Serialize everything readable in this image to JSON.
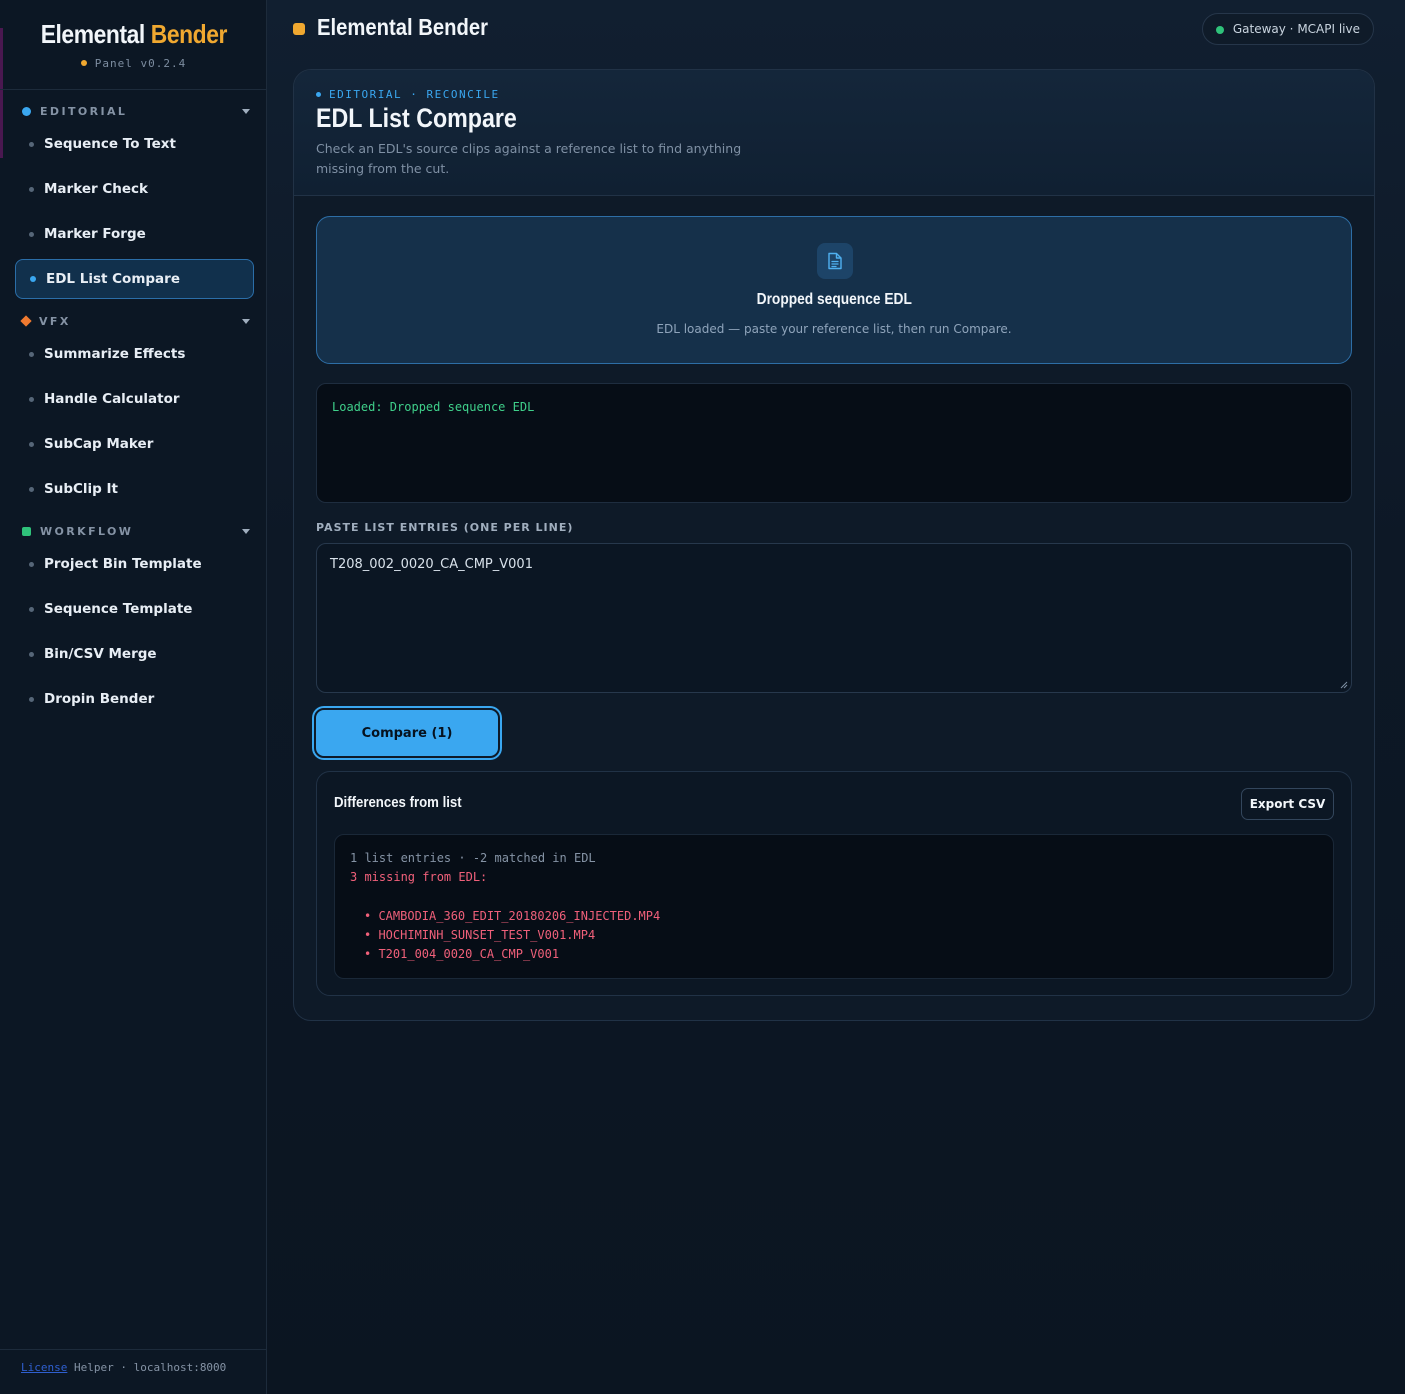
{
  "app": {
    "name_prefix": "Elemental",
    "name_highlight": "Bender",
    "version": "Panel v0.2.4"
  },
  "colors": {
    "accent_blue": "#3aa7f0",
    "accent_orange": "#f0a830",
    "status_green": "#2fc27a",
    "error_red": "#f0607a"
  },
  "sidebar": {
    "sections": [
      {
        "label": "EDITORIAL",
        "icon": "circle-icon",
        "items": [
          {
            "label": "Sequence To Text",
            "active": false
          },
          {
            "label": "Marker Check",
            "active": false
          },
          {
            "label": "Marker Forge",
            "active": false
          },
          {
            "label": "EDL List Compare",
            "active": true
          }
        ]
      },
      {
        "label": "VFX",
        "icon": "diamond-icon",
        "items": [
          {
            "label": "Summarize Effects",
            "active": false
          },
          {
            "label": "Handle Calculator",
            "active": false
          },
          {
            "label": "SubCap Maker",
            "active": false
          },
          {
            "label": "SubClip It",
            "active": false
          }
        ]
      },
      {
        "label": "WORKFLOW",
        "icon": "square-icon",
        "items": [
          {
            "label": "Project Bin Template",
            "active": false
          },
          {
            "label": "Sequence Template",
            "active": false
          },
          {
            "label": "Bin/CSV Merge",
            "active": false
          },
          {
            "label": "Dropin Bender",
            "active": false
          }
        ]
      }
    ],
    "footer": {
      "link": "License",
      "text": "Helper · localhost:8000"
    }
  },
  "topbar": {
    "title": "Elemental Bender",
    "status": "Gateway · MCAPI live"
  },
  "page": {
    "breadcrumb": "EDITORIAL · RECONCILE",
    "title": "EDL List Compare",
    "description": "Check an EDL's source clips against a reference list to find anything missing from the cut."
  },
  "dropzone": {
    "icon": "document-icon",
    "title": "Dropped sequence EDL",
    "subtitle": "EDL loaded — paste your reference list, then run Compare."
  },
  "log": {
    "text": "Loaded: Dropped sequence EDL"
  },
  "list_input": {
    "label": "PASTE LIST ENTRIES (ONE PER LINE)",
    "value": "T208_002_0020_CA_CMP_V001"
  },
  "compare_button": {
    "label": "Compare (1)"
  },
  "results": {
    "title": "Differences from list",
    "export_label": "Export CSV",
    "summary": "1 list entries · -2 matched in EDL",
    "missing_header": "3 missing from EDL:",
    "missing": [
      "CAMBODIA_360_EDIT_20180206_INJECTED.MP4",
      "HOCHIMINH_SUNSET_TEST_V001.MP4",
      "T201_004_0020_CA_CMP_V001"
    ]
  }
}
